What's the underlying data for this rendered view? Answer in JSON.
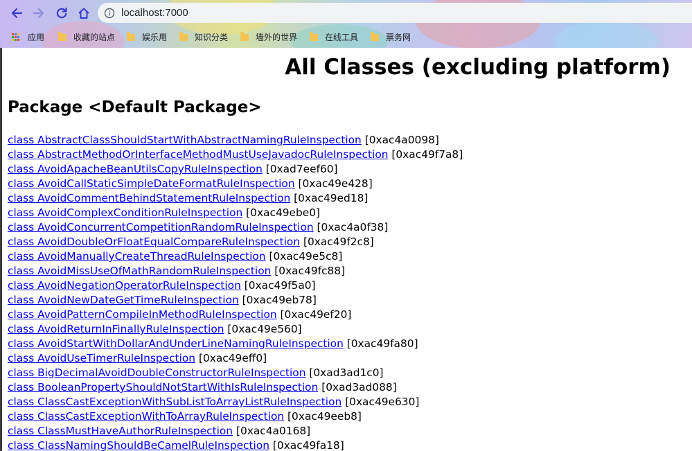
{
  "browser": {
    "url": "localhost:7000",
    "bookmarks": [
      {
        "label": "应用",
        "icon": "apps-grid-icon"
      },
      {
        "label": "收藏的站点",
        "icon": "folder-icon"
      },
      {
        "label": "娱乐用",
        "icon": "folder-icon"
      },
      {
        "label": "知识分类",
        "icon": "folder-icon"
      },
      {
        "label": "墙外的世界",
        "icon": "folder-icon"
      },
      {
        "label": "在线工具",
        "icon": "folder-icon"
      },
      {
        "label": "票务网",
        "icon": "folder-icon"
      }
    ]
  },
  "page": {
    "title": "All Classes (excluding platform)",
    "package_heading": "Package <Default Package>",
    "classes": [
      {
        "name": "class AbstractClassShouldStartWithAbstractNamingRuleInspection",
        "addr": " [0xac4a0098]"
      },
      {
        "name": "class AbstractMethodOrInterfaceMethodMustUseJavadocRuleInspection",
        "addr": " [0xac49f7a8]"
      },
      {
        "name": "class AvoidApacheBeanUtilsCopyRuleInspection",
        "addr": " [0xad7eef60]"
      },
      {
        "name": "class AvoidCallStaticSimpleDateFormatRuleInspection",
        "addr": " [0xac49e428]"
      },
      {
        "name": "class AvoidCommentBehindStatementRuleInspection",
        "addr": " [0xac49ed18]"
      },
      {
        "name": "class AvoidComplexConditionRuleInspection",
        "addr": " [0xac49ebe0]"
      },
      {
        "name": "class AvoidConcurrentCompetitionRandomRuleInspection",
        "addr": " [0xac4a0f38]"
      },
      {
        "name": "class AvoidDoubleOrFloatEqualCompareRuleInspection",
        "addr": " [0xac49f2c8]"
      },
      {
        "name": "class AvoidManuallyCreateThreadRuleInspection",
        "addr": " [0xac49e5c8]"
      },
      {
        "name": "class AvoidMissUseOfMathRandomRuleInspection",
        "addr": " [0xac49fc88]"
      },
      {
        "name": "class AvoidNegationOperatorRuleInspection",
        "addr": " [0xac49f5a0]"
      },
      {
        "name": "class AvoidNewDateGetTimeRuleInspection",
        "addr": " [0xac49eb78]"
      },
      {
        "name": "class AvoidPatternCompileInMethodRuleInspection",
        "addr": " [0xac49ef20]"
      },
      {
        "name": "class AvoidReturnInFinallyRuleInspection",
        "addr": " [0xac49e560]"
      },
      {
        "name": "class AvoidStartWithDollarAndUnderLineNamingRuleInspection",
        "addr": " [0xac49fa80]"
      },
      {
        "name": "class AvoidUseTimerRuleInspection",
        "addr": " [0xac49eff0]"
      },
      {
        "name": "class BigDecimalAvoidDoubleConstructorRuleInspection",
        "addr": " [0xad3ad1c0]"
      },
      {
        "name": "class BooleanPropertyShouldNotStartWithIsRuleInspection",
        "addr": " [0xad3ad088]"
      },
      {
        "name": "class ClassCastExceptionWithSubListToArrayListRuleInspection",
        "addr": " [0xac49e630]"
      },
      {
        "name": "class ClassCastExceptionWithToArrayRuleInspection",
        "addr": " [0xac49eeb8]"
      },
      {
        "name": "class ClassMustHaveAuthorRuleInspection",
        "addr": " [0xac4a0168]"
      },
      {
        "name": "class ClassNamingShouldBeCamelRuleInspection",
        "addr": " [0xac49fa18]"
      }
    ]
  }
}
